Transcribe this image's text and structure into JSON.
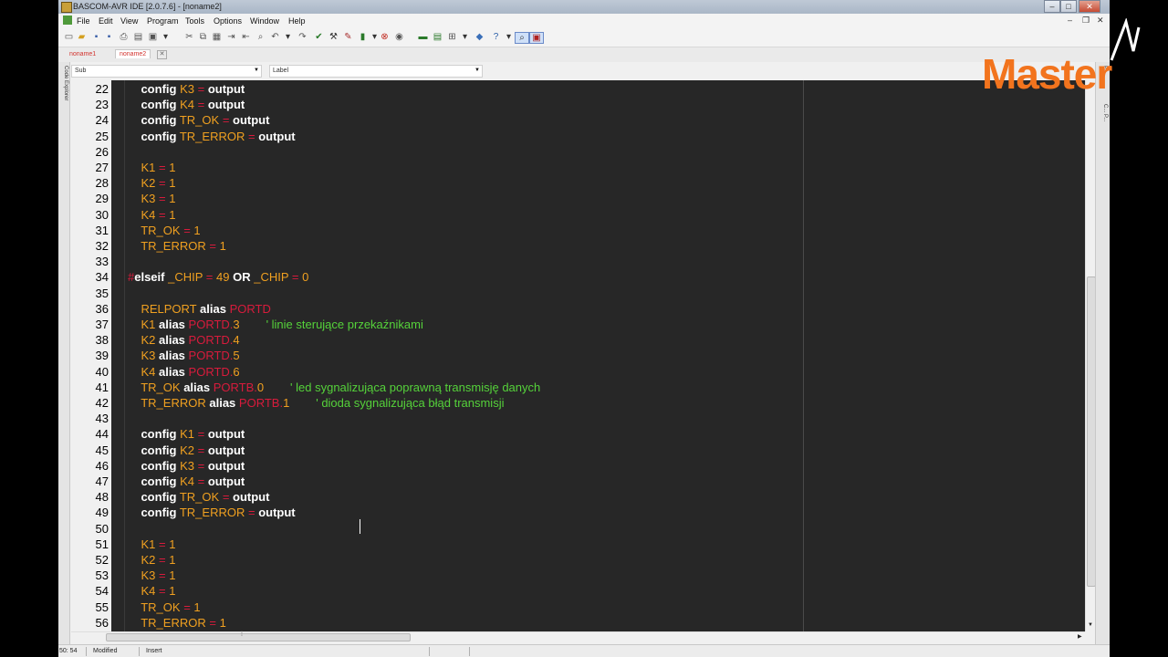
{
  "window": {
    "title": "BASCOM-AVR IDE [2.0.7.6] - [noname2]"
  },
  "menu": [
    "File",
    "Edit",
    "View",
    "Program",
    "Tools",
    "Options",
    "Window",
    "Help"
  ],
  "tabs": [
    {
      "label": "noname1",
      "active": false
    },
    {
      "label": "noname2",
      "active": true
    }
  ],
  "combos": {
    "sub_label": "Sub",
    "label_label": "Label"
  },
  "side_panels": {
    "left": "Code Explorer",
    "right_top": "P...",
    "right_mid": "C... P..."
  },
  "editor": {
    "background": "#272727",
    "colors": {
      "keyword": "#ffffff",
      "identifier": "#f0a020",
      "operator": "#d81b3c",
      "port": "#d81b3c",
      "comment": "#55d23a"
    },
    "lines": [
      {
        "n": "22",
        "tokens": [
          {
            "t": "    ",
            "c": ""
          },
          {
            "t": "config",
            "c": "kw"
          },
          {
            "t": " ",
            "c": ""
          },
          {
            "t": "K3",
            "c": "id"
          },
          {
            "t": " ",
            "c": ""
          },
          {
            "t": "=",
            "c": "op"
          },
          {
            "t": " ",
            "c": ""
          },
          {
            "t": "output",
            "c": "kw"
          }
        ]
      },
      {
        "n": "23",
        "tokens": [
          {
            "t": "    ",
            "c": ""
          },
          {
            "t": "config",
            "c": "kw"
          },
          {
            "t": " ",
            "c": ""
          },
          {
            "t": "K4",
            "c": "id"
          },
          {
            "t": " ",
            "c": ""
          },
          {
            "t": "=",
            "c": "op"
          },
          {
            "t": " ",
            "c": ""
          },
          {
            "t": "output",
            "c": "kw"
          }
        ]
      },
      {
        "n": "24",
        "tokens": [
          {
            "t": "    ",
            "c": ""
          },
          {
            "t": "config",
            "c": "kw"
          },
          {
            "t": " ",
            "c": ""
          },
          {
            "t": "TR_OK",
            "c": "id"
          },
          {
            "t": " ",
            "c": ""
          },
          {
            "t": "=",
            "c": "op"
          },
          {
            "t": " ",
            "c": ""
          },
          {
            "t": "output",
            "c": "kw"
          }
        ]
      },
      {
        "n": "25",
        "tokens": [
          {
            "t": "    ",
            "c": ""
          },
          {
            "t": "config",
            "c": "kw"
          },
          {
            "t": " ",
            "c": ""
          },
          {
            "t": "TR_ERROR",
            "c": "id"
          },
          {
            "t": " ",
            "c": ""
          },
          {
            "t": "=",
            "c": "op"
          },
          {
            "t": " ",
            "c": ""
          },
          {
            "t": "output",
            "c": "kw"
          }
        ]
      },
      {
        "n": "26",
        "tokens": []
      },
      {
        "n": "27",
        "tokens": [
          {
            "t": "    ",
            "c": ""
          },
          {
            "t": "K1",
            "c": "id"
          },
          {
            "t": " ",
            "c": ""
          },
          {
            "t": "=",
            "c": "op"
          },
          {
            "t": " ",
            "c": ""
          },
          {
            "t": "1",
            "c": "id"
          }
        ]
      },
      {
        "n": "28",
        "tokens": [
          {
            "t": "    ",
            "c": ""
          },
          {
            "t": "K2",
            "c": "id"
          },
          {
            "t": " ",
            "c": ""
          },
          {
            "t": "=",
            "c": "op"
          },
          {
            "t": " ",
            "c": ""
          },
          {
            "t": "1",
            "c": "id"
          }
        ]
      },
      {
        "n": "29",
        "tokens": [
          {
            "t": "    ",
            "c": ""
          },
          {
            "t": "K3",
            "c": "id"
          },
          {
            "t": " ",
            "c": ""
          },
          {
            "t": "=",
            "c": "op"
          },
          {
            "t": " ",
            "c": ""
          },
          {
            "t": "1",
            "c": "id"
          }
        ]
      },
      {
        "n": "30",
        "tokens": [
          {
            "t": "    ",
            "c": ""
          },
          {
            "t": "K4",
            "c": "id"
          },
          {
            "t": " ",
            "c": ""
          },
          {
            "t": "=",
            "c": "op"
          },
          {
            "t": " ",
            "c": ""
          },
          {
            "t": "1",
            "c": "id"
          }
        ]
      },
      {
        "n": "31",
        "tokens": [
          {
            "t": "    ",
            "c": ""
          },
          {
            "t": "TR_OK",
            "c": "id"
          },
          {
            "t": " ",
            "c": ""
          },
          {
            "t": "=",
            "c": "op"
          },
          {
            "t": " ",
            "c": ""
          },
          {
            "t": "1",
            "c": "id"
          }
        ]
      },
      {
        "n": "32",
        "tokens": [
          {
            "t": "    ",
            "c": ""
          },
          {
            "t": "TR_ERROR",
            "c": "id"
          },
          {
            "t": " ",
            "c": ""
          },
          {
            "t": "=",
            "c": "op"
          },
          {
            "t": " ",
            "c": ""
          },
          {
            "t": "1",
            "c": "id"
          }
        ]
      },
      {
        "n": "33",
        "tokens": []
      },
      {
        "n": "34",
        "tokens": [
          {
            "t": "#",
            "c": "op"
          },
          {
            "t": "elseif",
            "c": "kw"
          },
          {
            "t": " ",
            "c": ""
          },
          {
            "t": "_CHIP",
            "c": "id"
          },
          {
            "t": " ",
            "c": ""
          },
          {
            "t": "=",
            "c": "op"
          },
          {
            "t": " ",
            "c": ""
          },
          {
            "t": "49",
            "c": "id"
          },
          {
            "t": " ",
            "c": ""
          },
          {
            "t": "OR",
            "c": "kw"
          },
          {
            "t": " ",
            "c": ""
          },
          {
            "t": "_CHIP",
            "c": "id"
          },
          {
            "t": " ",
            "c": ""
          },
          {
            "t": "=",
            "c": "op"
          },
          {
            "t": " ",
            "c": ""
          },
          {
            "t": "0",
            "c": "id"
          }
        ]
      },
      {
        "n": "35",
        "tokens": []
      },
      {
        "n": "36",
        "tokens": [
          {
            "t": "    ",
            "c": ""
          },
          {
            "t": "RELPORT",
            "c": "id"
          },
          {
            "t": " ",
            "c": ""
          },
          {
            "t": "alias",
            "c": "kw"
          },
          {
            "t": " ",
            "c": ""
          },
          {
            "t": "PORTD",
            "c": "pt"
          }
        ]
      },
      {
        "n": "37",
        "tokens": [
          {
            "t": "    ",
            "c": ""
          },
          {
            "t": "K1",
            "c": "id"
          },
          {
            "t": " ",
            "c": ""
          },
          {
            "t": "alias",
            "c": "kw"
          },
          {
            "t": " ",
            "c": ""
          },
          {
            "t": "PORTD.",
            "c": "pt"
          },
          {
            "t": "3",
            "c": "id"
          },
          {
            "t": "        ",
            "c": ""
          },
          {
            "t": "' linie sterujące przekaźnikami",
            "c": "cm"
          }
        ]
      },
      {
        "n": "38",
        "tokens": [
          {
            "t": "    ",
            "c": ""
          },
          {
            "t": "K2",
            "c": "id"
          },
          {
            "t": " ",
            "c": ""
          },
          {
            "t": "alias",
            "c": "kw"
          },
          {
            "t": " ",
            "c": ""
          },
          {
            "t": "PORTD.",
            "c": "pt"
          },
          {
            "t": "4",
            "c": "id"
          }
        ]
      },
      {
        "n": "39",
        "tokens": [
          {
            "t": "    ",
            "c": ""
          },
          {
            "t": "K3",
            "c": "id"
          },
          {
            "t": " ",
            "c": ""
          },
          {
            "t": "alias",
            "c": "kw"
          },
          {
            "t": " ",
            "c": ""
          },
          {
            "t": "PORTD.",
            "c": "pt"
          },
          {
            "t": "5",
            "c": "id"
          }
        ]
      },
      {
        "n": "40",
        "tokens": [
          {
            "t": "    ",
            "c": ""
          },
          {
            "t": "K4",
            "c": "id"
          },
          {
            "t": " ",
            "c": ""
          },
          {
            "t": "alias",
            "c": "kw"
          },
          {
            "t": " ",
            "c": ""
          },
          {
            "t": "PORTD.",
            "c": "pt"
          },
          {
            "t": "6",
            "c": "id"
          }
        ]
      },
      {
        "n": "41",
        "tokens": [
          {
            "t": "    ",
            "c": ""
          },
          {
            "t": "TR_OK",
            "c": "id"
          },
          {
            "t": " ",
            "c": ""
          },
          {
            "t": "alias",
            "c": "kw"
          },
          {
            "t": " ",
            "c": ""
          },
          {
            "t": "PORTB.",
            "c": "pt"
          },
          {
            "t": "0",
            "c": "id"
          },
          {
            "t": "        ",
            "c": ""
          },
          {
            "t": "' led sygnalizująca poprawną transmisję danych",
            "c": "cm"
          }
        ]
      },
      {
        "n": "42",
        "tokens": [
          {
            "t": "    ",
            "c": ""
          },
          {
            "t": "TR_ERROR",
            "c": "id"
          },
          {
            "t": " ",
            "c": ""
          },
          {
            "t": "alias",
            "c": "kw"
          },
          {
            "t": " ",
            "c": ""
          },
          {
            "t": "PORTB.",
            "c": "pt"
          },
          {
            "t": "1",
            "c": "id"
          },
          {
            "t": "        ",
            "c": ""
          },
          {
            "t": "' dioda sygnalizująca błąd transmisji",
            "c": "cm"
          }
        ]
      },
      {
        "n": "43",
        "tokens": []
      },
      {
        "n": "44",
        "tokens": [
          {
            "t": "    ",
            "c": ""
          },
          {
            "t": "config",
            "c": "kw"
          },
          {
            "t": " ",
            "c": ""
          },
          {
            "t": "K1",
            "c": "id"
          },
          {
            "t": " ",
            "c": ""
          },
          {
            "t": "=",
            "c": "op"
          },
          {
            "t": " ",
            "c": ""
          },
          {
            "t": "output",
            "c": "kw"
          }
        ]
      },
      {
        "n": "45",
        "tokens": [
          {
            "t": "    ",
            "c": ""
          },
          {
            "t": "config",
            "c": "kw"
          },
          {
            "t": " ",
            "c": ""
          },
          {
            "t": "K2",
            "c": "id"
          },
          {
            "t": " ",
            "c": ""
          },
          {
            "t": "=",
            "c": "op"
          },
          {
            "t": " ",
            "c": ""
          },
          {
            "t": "output",
            "c": "kw"
          }
        ]
      },
      {
        "n": "46",
        "tokens": [
          {
            "t": "    ",
            "c": ""
          },
          {
            "t": "config",
            "c": "kw"
          },
          {
            "t": " ",
            "c": ""
          },
          {
            "t": "K3",
            "c": "id"
          },
          {
            "t": " ",
            "c": ""
          },
          {
            "t": "=",
            "c": "op"
          },
          {
            "t": " ",
            "c": ""
          },
          {
            "t": "output",
            "c": "kw"
          }
        ]
      },
      {
        "n": "47",
        "tokens": [
          {
            "t": "    ",
            "c": ""
          },
          {
            "t": "config",
            "c": "kw"
          },
          {
            "t": " ",
            "c": ""
          },
          {
            "t": "K4",
            "c": "id"
          },
          {
            "t": " ",
            "c": ""
          },
          {
            "t": "=",
            "c": "op"
          },
          {
            "t": " ",
            "c": ""
          },
          {
            "t": "output",
            "c": "kw"
          }
        ]
      },
      {
        "n": "48",
        "tokens": [
          {
            "t": "    ",
            "c": ""
          },
          {
            "t": "config",
            "c": "kw"
          },
          {
            "t": " ",
            "c": ""
          },
          {
            "t": "TR_OK",
            "c": "id"
          },
          {
            "t": " ",
            "c": ""
          },
          {
            "t": "=",
            "c": "op"
          },
          {
            "t": " ",
            "c": ""
          },
          {
            "t": "output",
            "c": "kw"
          }
        ]
      },
      {
        "n": "49",
        "tokens": [
          {
            "t": "    ",
            "c": ""
          },
          {
            "t": "config",
            "c": "kw"
          },
          {
            "t": " ",
            "c": ""
          },
          {
            "t": "TR_ERROR",
            "c": "id"
          },
          {
            "t": " ",
            "c": ""
          },
          {
            "t": "=",
            "c": "op"
          },
          {
            "t": " ",
            "c": ""
          },
          {
            "t": "output",
            "c": "kw"
          }
        ]
      },
      {
        "n": "50",
        "tokens": []
      },
      {
        "n": "51",
        "tokens": [
          {
            "t": "    ",
            "c": ""
          },
          {
            "t": "K1",
            "c": "id"
          },
          {
            "t": " ",
            "c": ""
          },
          {
            "t": "=",
            "c": "op"
          },
          {
            "t": " ",
            "c": ""
          },
          {
            "t": "1",
            "c": "id"
          }
        ]
      },
      {
        "n": "52",
        "tokens": [
          {
            "t": "    ",
            "c": ""
          },
          {
            "t": "K2",
            "c": "id"
          },
          {
            "t": " ",
            "c": ""
          },
          {
            "t": "=",
            "c": "op"
          },
          {
            "t": " ",
            "c": ""
          },
          {
            "t": "1",
            "c": "id"
          }
        ]
      },
      {
        "n": "53",
        "tokens": [
          {
            "t": "    ",
            "c": ""
          },
          {
            "t": "K3",
            "c": "id"
          },
          {
            "t": " ",
            "c": ""
          },
          {
            "t": "=",
            "c": "op"
          },
          {
            "t": " ",
            "c": ""
          },
          {
            "t": "1",
            "c": "id"
          }
        ]
      },
      {
        "n": "54",
        "tokens": [
          {
            "t": "    ",
            "c": ""
          },
          {
            "t": "K4",
            "c": "id"
          },
          {
            "t": " ",
            "c": ""
          },
          {
            "t": "=",
            "c": "op"
          },
          {
            "t": " ",
            "c": ""
          },
          {
            "t": "1",
            "c": "id"
          }
        ]
      },
      {
        "n": "55",
        "tokens": [
          {
            "t": "    ",
            "c": ""
          },
          {
            "t": "TR_OK",
            "c": "id"
          },
          {
            "t": " ",
            "c": ""
          },
          {
            "t": "=",
            "c": "op"
          },
          {
            "t": " ",
            "c": ""
          },
          {
            "t": "1",
            "c": "id"
          }
        ]
      },
      {
        "n": "56",
        "tokens": [
          {
            "t": "    ",
            "c": ""
          },
          {
            "t": "TR_ERROR",
            "c": "id"
          },
          {
            "t": " ",
            "c": ""
          },
          {
            "t": "=",
            "c": "op"
          },
          {
            "t": " ",
            "c": ""
          },
          {
            "t": "1",
            "c": "id"
          }
        ]
      }
    ]
  },
  "status": {
    "position": "50: 54",
    "modified": "Modified",
    "mode": "Insert"
  },
  "watermark": {
    "text": "Master",
    "color": "#f2741e"
  }
}
